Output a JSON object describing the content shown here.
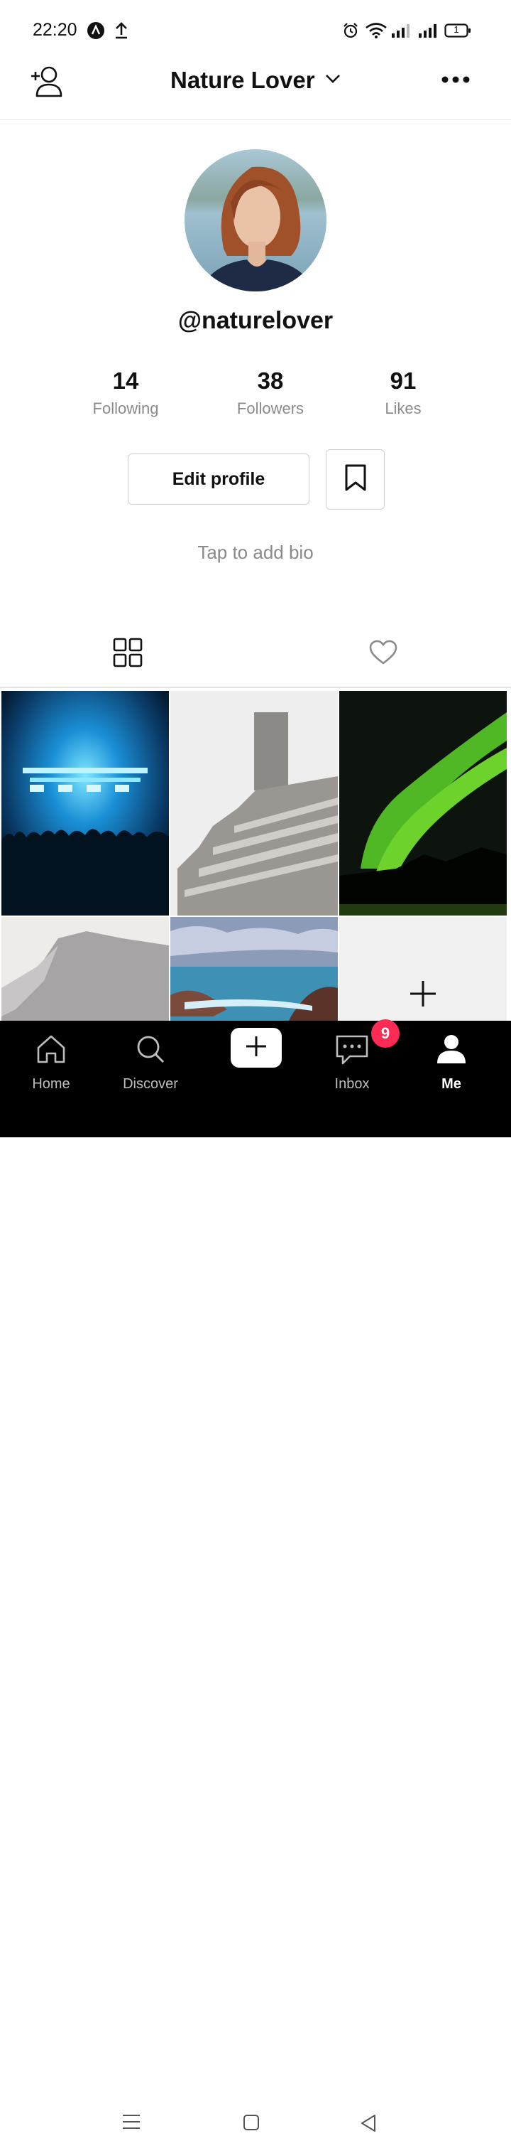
{
  "status_bar": {
    "time": "22:20",
    "icons": [
      "app-notification-icon",
      "upload-icon",
      "alarm-icon",
      "wifi-icon",
      "signal-icon",
      "signal-icon",
      "battery-icon"
    ],
    "battery_level": "1"
  },
  "header": {
    "title": "Nature Lover",
    "icons": [
      "add-user-icon",
      "chevron-down-icon",
      "more-options-icon"
    ]
  },
  "profile": {
    "username": "@naturelover",
    "stats": [
      {
        "value": "14",
        "label": "Following"
      },
      {
        "value": "38",
        "label": "Followers"
      },
      {
        "value": "91",
        "label": "Likes"
      }
    ],
    "edit_button": "Edit profile",
    "bio_placeholder": "Tap to add bio"
  },
  "tabs": [
    {
      "icon": "grid-icon",
      "active": true
    },
    {
      "icon": "heart-icon",
      "active": false
    }
  ],
  "grid": {
    "tiles": [
      "concert-photo",
      "building-photo",
      "aurora-photo",
      "mountain-photo",
      "sea-rocks-photo",
      "add-photo-tile"
    ]
  },
  "bottom_nav": {
    "items": [
      {
        "label": "Home",
        "icon": "home-icon"
      },
      {
        "label": "Discover",
        "icon": "search-icon"
      },
      {
        "label": "",
        "icon": "plus-icon"
      },
      {
        "label": "Inbox",
        "icon": "message-icon"
      },
      {
        "label": "Me",
        "icon": "person-icon"
      }
    ],
    "inbox_badge": "9"
  },
  "colors": {
    "badge": "#fe2c55",
    "nav_background": "#000000",
    "secondary_text": "#8a8a8a"
  }
}
